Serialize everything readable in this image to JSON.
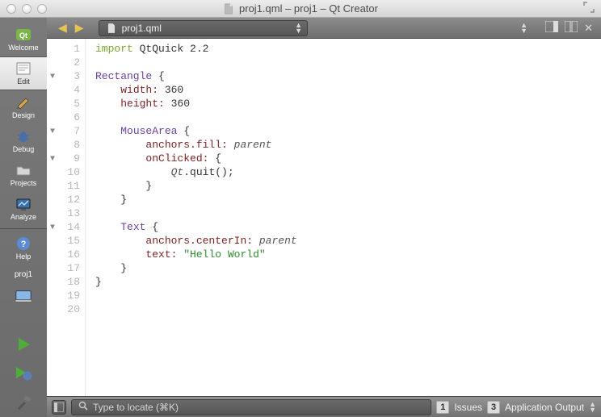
{
  "window": {
    "title": "proj1.qml – proj1 – Qt Creator"
  },
  "sidebar": {
    "items": [
      {
        "label": "Welcome"
      },
      {
        "label": "Edit"
      },
      {
        "label": "Design"
      },
      {
        "label": "Debug"
      },
      {
        "label": "Projects"
      },
      {
        "label": "Analyze"
      },
      {
        "label": "Help"
      }
    ],
    "project": "proj1"
  },
  "topbar": {
    "filename": "proj1.qml"
  },
  "editor": {
    "line_count": 20,
    "fold_lines": [
      3,
      7,
      9,
      14
    ],
    "code_tokens": [
      [
        {
          "t": "import ",
          "c": "kw"
        },
        {
          "t": "QtQuick ",
          "c": ""
        },
        {
          "t": "2.2",
          "c": ""
        }
      ],
      [],
      [
        {
          "t": "Rectangle",
          "c": "type"
        },
        {
          "t": " {",
          "c": ""
        }
      ],
      [
        {
          "t": "    ",
          "c": ""
        },
        {
          "t": "width:",
          "c": "prop"
        },
        {
          "t": " 360",
          "c": ""
        }
      ],
      [
        {
          "t": "    ",
          "c": ""
        },
        {
          "t": "height:",
          "c": "prop"
        },
        {
          "t": " 360",
          "c": ""
        }
      ],
      [],
      [
        {
          "t": "    ",
          "c": ""
        },
        {
          "t": "MouseArea",
          "c": "type"
        },
        {
          "t": " {",
          "c": ""
        }
      ],
      [
        {
          "t": "        ",
          "c": ""
        },
        {
          "t": "anchors.fill:",
          "c": "prop"
        },
        {
          "t": " ",
          "c": ""
        },
        {
          "t": "parent",
          "c": "it"
        }
      ],
      [
        {
          "t": "        ",
          "c": ""
        },
        {
          "t": "onClicked:",
          "c": "prop"
        },
        {
          "t": " {",
          "c": ""
        }
      ],
      [
        {
          "t": "            ",
          "c": ""
        },
        {
          "t": "Qt",
          "c": "it"
        },
        {
          "t": ".quit();",
          "c": ""
        }
      ],
      [
        {
          "t": "        }",
          "c": ""
        }
      ],
      [
        {
          "t": "    }",
          "c": ""
        }
      ],
      [],
      [
        {
          "t": "    ",
          "c": ""
        },
        {
          "t": "Text",
          "c": "type"
        },
        {
          "t": " {",
          "c": ""
        }
      ],
      [
        {
          "t": "        ",
          "c": ""
        },
        {
          "t": "anchors.centerIn:",
          "c": "prop"
        },
        {
          "t": " ",
          "c": ""
        },
        {
          "t": "parent",
          "c": "it"
        }
      ],
      [
        {
          "t": "        ",
          "c": ""
        },
        {
          "t": "text:",
          "c": "prop"
        },
        {
          "t": " ",
          "c": ""
        },
        {
          "t": "\"Hello World\"",
          "c": "str"
        }
      ],
      [
        {
          "t": "    }",
          "c": ""
        }
      ],
      [
        {
          "t": "}",
          "c": ""
        }
      ],
      [],
      []
    ]
  },
  "bottombar": {
    "locator_placeholder": "Type to locate (⌘K)",
    "panels": [
      {
        "num": "1",
        "label": "Issues"
      },
      {
        "num": "3",
        "label": "Application Output"
      }
    ]
  }
}
